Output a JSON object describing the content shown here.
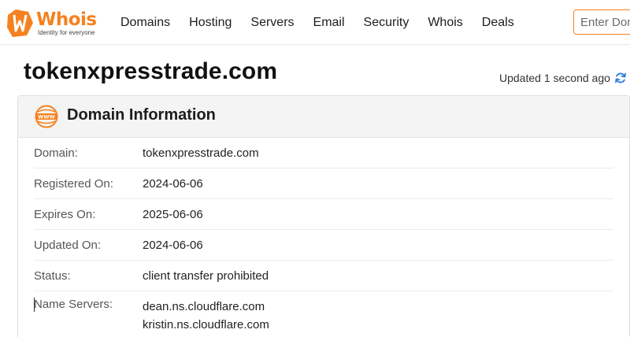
{
  "header": {
    "logo_text": "Whois",
    "logo_tagline": "Identity for everyone",
    "nav": [
      "Domains",
      "Hosting",
      "Servers",
      "Email",
      "Security",
      "Whois",
      "Deals"
    ],
    "search_placeholder": "Enter Domain or IP"
  },
  "page": {
    "title": "tokenxpresstrade.com",
    "updated": "Updated 1 second ago"
  },
  "card": {
    "title": "Domain Information",
    "rows": [
      {
        "label": "Domain:",
        "value": "tokenxpresstrade.com"
      },
      {
        "label": "Registered On:",
        "value": "2024-06-06"
      },
      {
        "label": "Expires On:",
        "value": "2025-06-06"
      },
      {
        "label": "Updated On:",
        "value": "2024-06-06"
      },
      {
        "label": "Status:",
        "value": "client transfer prohibited"
      }
    ],
    "name_servers_label": "Name Servers:",
    "name_servers": [
      "dean.ns.cloudflare.com",
      "kristin.ns.cloudflare.com"
    ]
  },
  "colors": {
    "brand": "#f58220",
    "refresh": "#2a7de1"
  },
  "icons": {
    "logo": "whois-logo-icon",
    "refresh": "refresh-icon",
    "domain": "www-globe-icon"
  }
}
